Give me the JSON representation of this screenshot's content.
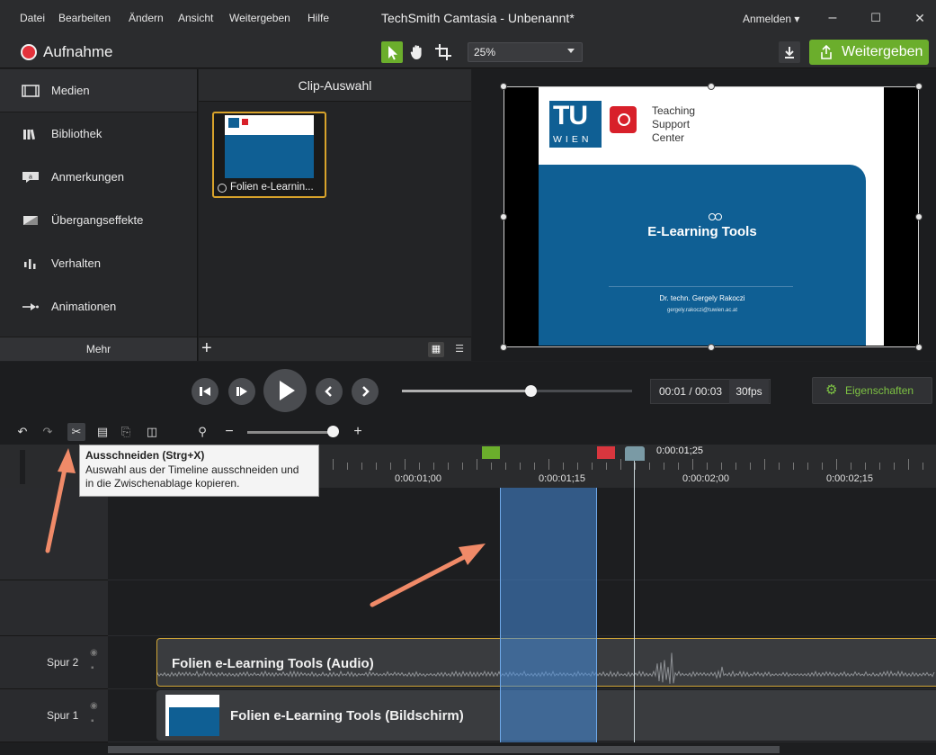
{
  "menu": [
    "Datei",
    "Bearbeiten",
    "Ändern",
    "Ansicht",
    "Weitergeben",
    "Hilfe"
  ],
  "window": {
    "title": "TechSmith Camtasia - Unbenannt*",
    "signin": "Anmelden ▾",
    "minimize": "–",
    "maximize": "☐",
    "close": "✕"
  },
  "toolbar": {
    "record_label": "Aufnahme",
    "zoom_value": "25%",
    "share_label": "Weitergeben"
  },
  "sidebar": {
    "items": [
      {
        "label": "Medien",
        "icon": "film-icon"
      },
      {
        "label": "Bibliothek",
        "icon": "library-icon"
      },
      {
        "label": "Anmerkungen",
        "icon": "annotation-icon"
      },
      {
        "label": "Übergangseffekte",
        "icon": "transition-icon"
      },
      {
        "label": "Verhalten",
        "icon": "behavior-icon"
      },
      {
        "label": "Animationen",
        "icon": "animation-icon"
      }
    ],
    "more_label": "Mehr"
  },
  "clips": {
    "header": "Clip-Auswahl",
    "items": [
      {
        "name": "Folien e-Learnin..."
      }
    ]
  },
  "slide": {
    "tu_text": "TU",
    "wien_text": "WIEN",
    "tsc_line1": "Teaching",
    "tsc_line2": "Support",
    "tsc_line3": "Center",
    "title": "E-Learning Tools",
    "author": "Dr. techn. Gergely Rakoczi",
    "email": "gergely.rakoczi@tuwien.ac.at"
  },
  "playback": {
    "position_fraction": 0.56,
    "time": "00:01 / 00:03",
    "fps": "30fps",
    "properties_label": "Eigenschaften"
  },
  "timeline": {
    "zoom_fraction": 0.95,
    "playhead_time": "0:00:01;25",
    "ruler_labels": [
      "0:00:01;00",
      "0:00:01;15",
      "0:00:02;00",
      "0:00:02;15"
    ],
    "tooltip_title": "Ausschneiden (Strg+X)",
    "tooltip_line1": "Auswahl aus der Timeline ausschneiden und",
    "tooltip_line2": "in die Zwischenablage kopieren.",
    "tracks": [
      {
        "name": "Spur 2",
        "clip": "Folien e-Learning Tools (Audio)"
      },
      {
        "name": "Spur 1",
        "clip": "Folien e-Learning Tools (Bildschirm)"
      }
    ]
  },
  "colors": {
    "accent_green": "#6bae2c",
    "record_red": "#e4323b",
    "selection_blue": "#468cdc",
    "slide_blue": "#0f5f94"
  }
}
